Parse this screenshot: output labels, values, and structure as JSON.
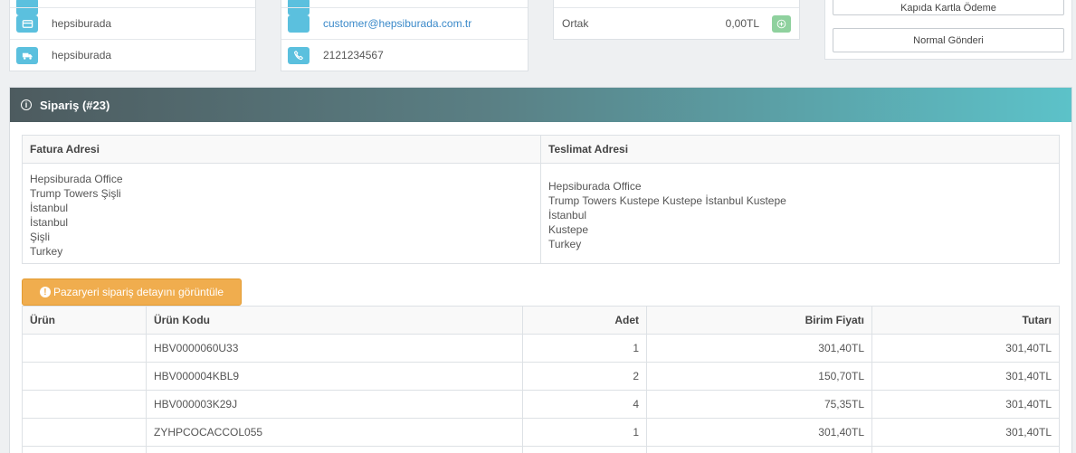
{
  "customer_panel": {
    "rows": [
      {
        "icon": "credit-card-icon",
        "text": "hepsiburada"
      },
      {
        "icon": "truck-icon",
        "text": "hepsiburada"
      }
    ]
  },
  "contact_panel": {
    "email": "customer@hepsiburada.com.tr",
    "phone": "2121234567",
    "email_icon": "envelope-icon",
    "phone_icon": "phone-icon"
  },
  "totals_panel": {
    "label": "Ortak",
    "value": "0,00TL",
    "add_icon": "plus-circle-icon"
  },
  "shipping_panel": {
    "payment_button": "Kapıda Kartla Ödeme",
    "shipping_button": "Normal Gönderi"
  },
  "order": {
    "title": "Sipariş (#23)",
    "billing_header": "Fatura Adresi",
    "shipping_header": "Teslimat Adresi",
    "billing_lines": [
      "Hepsiburada Office",
      "Trump Towers Şişli",
      "İstanbul",
      "İstanbul",
      "Şişli",
      "Turkey"
    ],
    "shipping_lines": [
      "Hepsiburada Office",
      "Trump Towers Kustepe Kustepe İstanbul Kustepe",
      "İstanbul",
      "Kustepe",
      "Turkey"
    ],
    "marketplace_button": "Pazaryeri sipariş detayını görüntüle",
    "columns": [
      "Ürün",
      "Ürün Kodu",
      "Adet",
      "Birim Fiyatı",
      "Tutarı"
    ],
    "items": [
      {
        "product": "",
        "code": "HBV0000060U33",
        "qty": "1",
        "unit_price": "301,40TL",
        "total": "301,40TL"
      },
      {
        "product": "",
        "code": "HBV000004KBL9",
        "qty": "2",
        "unit_price": "150,70TL",
        "total": "301,40TL"
      },
      {
        "product": "",
        "code": "HBV000003K29J",
        "qty": "4",
        "unit_price": "75,35TL",
        "total": "301,40TL"
      },
      {
        "product": "",
        "code": "ZYHPCOCACCOL055",
        "qty": "1",
        "unit_price": "301,40TL",
        "total": "301,40TL"
      }
    ]
  },
  "colors": {
    "icon_bg": "#5bc0de",
    "warning": "#f0ad4e",
    "success": "#8fd19e",
    "link": "#3a89c9"
  }
}
